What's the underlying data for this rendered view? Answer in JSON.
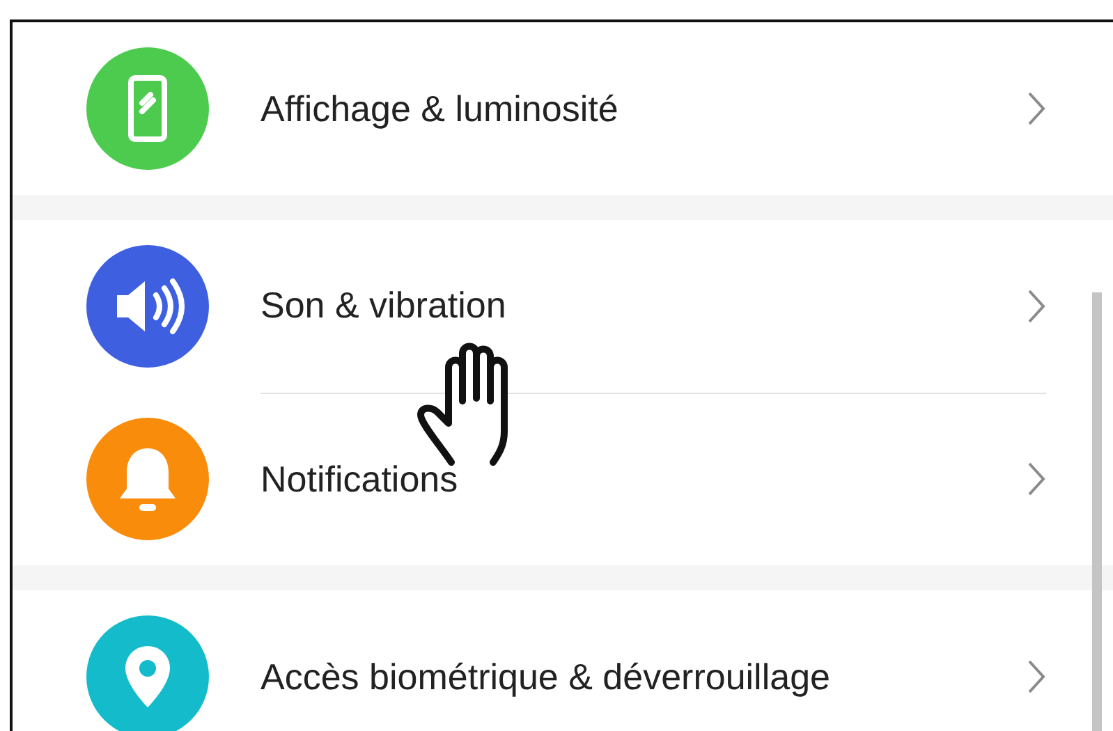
{
  "groups": [
    {
      "items": [
        {
          "label": "Affichage & luminosité",
          "kind": "display",
          "color": "#4ccb4f"
        }
      ]
    },
    {
      "items": [
        {
          "label": "Son & vibration",
          "kind": "sound",
          "color": "#3e5fe0"
        },
        {
          "label": "Notifications",
          "kind": "bell",
          "color": "#fa8c0c"
        }
      ]
    },
    {
      "items": [
        {
          "label": "Accès biométrique & déverrouillage",
          "kind": "lock",
          "color": "#14bccb"
        }
      ]
    }
  ]
}
